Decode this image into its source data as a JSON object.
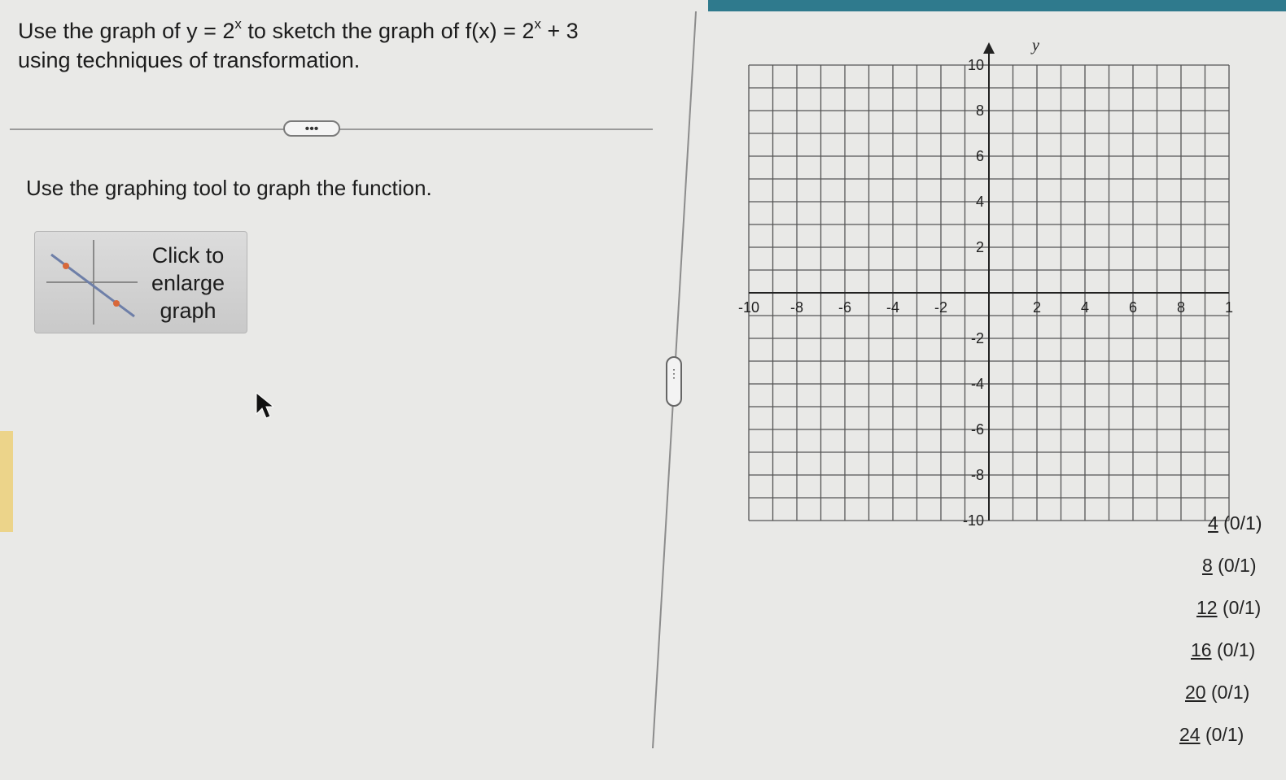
{
  "question": {
    "prefix": "Use the graph of y = 2",
    "exp1": "x",
    "middle": " to sketch the graph of f(x) = 2",
    "exp2": "x",
    "suffix": " + 3",
    "line2": "using techniques of transformation."
  },
  "more_button": "•••",
  "instruction": "Use the graphing tool to graph the function.",
  "enlarge_button": {
    "line1": "Click to",
    "line2": "enlarge",
    "line3": "graph"
  },
  "splitter_handle": "⋮",
  "graph": {
    "axis_y_label": "y",
    "x_ticks": [
      "-10",
      "-8",
      "-6",
      "-4",
      "-2",
      "2",
      "4",
      "6",
      "8",
      "1"
    ],
    "y_ticks": [
      "10",
      "8",
      "6",
      "4",
      "2",
      "-2",
      "-4",
      "-6",
      "-8",
      "-10"
    ],
    "xlim": [
      -10,
      10
    ],
    "ylim": [
      -10,
      10
    ],
    "grid": true
  },
  "progress_items": [
    {
      "num": "4",
      "score": "(0/1)"
    },
    {
      "num": "8",
      "score": "(0/1)"
    },
    {
      "num": "12",
      "score": "(0/1)"
    },
    {
      "num": "16",
      "score": "(0/1)"
    },
    {
      "num": "20",
      "score": "(0/1)"
    },
    {
      "num": "24",
      "score": "(0/1)"
    }
  ],
  "colors": {
    "top_strip": "#2f7a8d",
    "left_accent": "#ecd48a",
    "thumb_line": "#6e7fa8",
    "thumb_point": "#d8683a"
  }
}
